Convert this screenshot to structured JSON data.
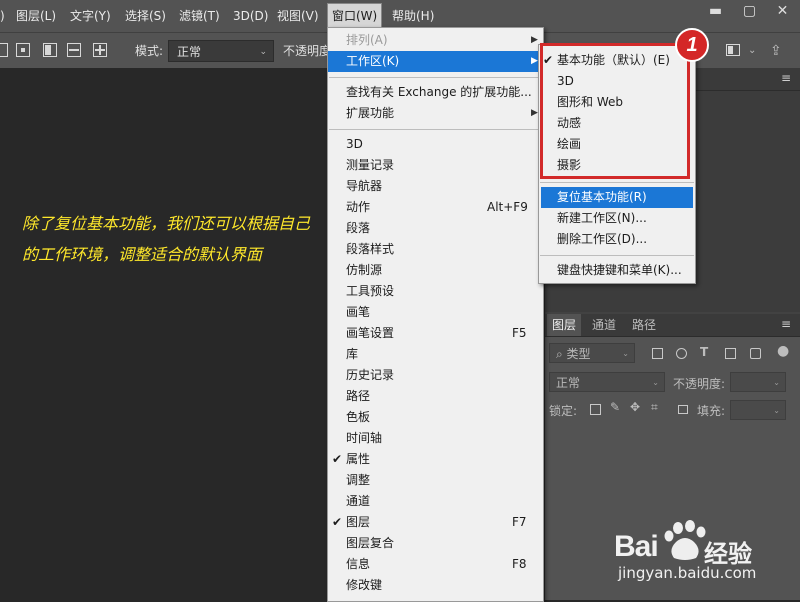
{
  "menubar": {
    "items": [
      "图层(L)",
      "文字(Y)",
      "选择(S)",
      "滤镜(T)",
      "3D(D)",
      "视图(V)",
      "窗口(W)",
      "帮助(H)"
    ],
    "window_controls": [
      "minimize-icon",
      "maximize-icon",
      "close-icon"
    ]
  },
  "optionsbar": {
    "mode_label": "模式:",
    "mode_value": "正常",
    "opacity_label": "不透明度"
  },
  "annotation": {
    "text": "除了复位基本功能，我们还可以根据自己的工作环境，调整适合的默认界面"
  },
  "window_menu": {
    "items": [
      {
        "label": "排列(A)",
        "disabled": true,
        "submenu": true
      },
      {
        "label": "工作区(K)",
        "highlighted": true,
        "submenu": true
      },
      {
        "label": "查找有关 Exchange 的扩展功能..."
      },
      {
        "label": "扩展功能",
        "submenu": true
      },
      {
        "label": "3D"
      },
      {
        "label": "测量记录"
      },
      {
        "label": "导航器"
      },
      {
        "label": "动作",
        "shortcut": "Alt+F9"
      },
      {
        "label": "段落"
      },
      {
        "label": "段落样式"
      },
      {
        "label": "仿制源"
      },
      {
        "label": "工具预设"
      },
      {
        "label": "画笔"
      },
      {
        "label": "画笔设置",
        "shortcut": "F5"
      },
      {
        "label": "库"
      },
      {
        "label": "历史记录"
      },
      {
        "label": "路径"
      },
      {
        "label": "色板"
      },
      {
        "label": "时间轴"
      },
      {
        "label": "属性",
        "checked": true
      },
      {
        "label": "调整"
      },
      {
        "label": "通道"
      },
      {
        "label": "图层",
        "checked": true,
        "shortcut": "F7"
      },
      {
        "label": "图层复合"
      },
      {
        "label": "信息",
        "shortcut": "F8"
      },
      {
        "label": "修改键"
      }
    ]
  },
  "workspace_menu": {
    "items": [
      {
        "label": "基本功能（默认）(E)",
        "checked": true
      },
      {
        "label": "3D"
      },
      {
        "label": "图形和 Web"
      },
      {
        "label": "动感"
      },
      {
        "label": "绘画"
      },
      {
        "label": "摄影"
      },
      {
        "label": "复位基本功能(R)",
        "highlighted": true
      },
      {
        "label": "新建工作区(N)..."
      },
      {
        "label": "删除工作区(D)..."
      },
      {
        "label": "键盘快捷键和菜单(K)..."
      }
    ],
    "badge": "1",
    "highlight_color": "#d22a2a"
  },
  "layers_panel": {
    "tabs": [
      "图层",
      "通道",
      "路径"
    ],
    "filter_value": "类型",
    "blend_value": "正常",
    "opacity_label": "不透明度:",
    "lock_label": "锁定:",
    "fill_label": "填充:"
  },
  "watermark": {
    "brand_text": "Bai",
    "brand_suffix": "经验",
    "url": "jingyan.baidu.com"
  },
  "colors": {
    "menu_highlight": "#1b77d6",
    "annotation": "#ffe82b",
    "panel_bg": "#535353",
    "canvas_bg": "#282828"
  }
}
